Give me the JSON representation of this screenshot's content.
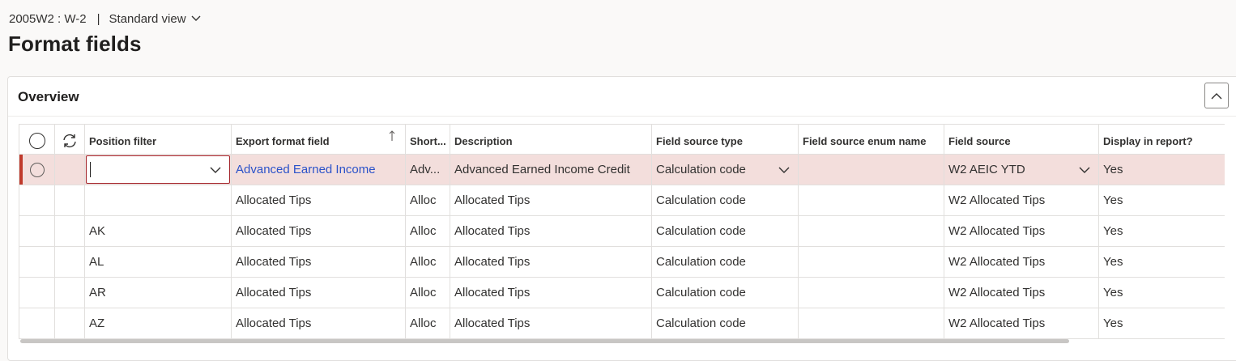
{
  "breadcrumb": {
    "record": "2005W2 : W-2",
    "separator": "|",
    "view": "Standard view"
  },
  "page_title": "Format fields",
  "section": {
    "title": "Overview"
  },
  "columns": [
    "Position filter",
    "Export format field",
    "Short...",
    "Description",
    "Field source type",
    "Field source enum name",
    "Field source",
    "Display in report?"
  ],
  "rows": [
    {
      "position": "",
      "export": "Advanced Earned Income",
      "short": "Adv...",
      "description": "Advanced Earned Income Credit",
      "source_type": "Calculation code",
      "enum_name": "",
      "source": "W2 AEIC YTD",
      "display": "Yes"
    },
    {
      "position": "",
      "export": "Allocated Tips",
      "short": "Alloc",
      "description": "Allocated Tips",
      "source_type": "Calculation code",
      "enum_name": "",
      "source": "W2 Allocated Tips",
      "display": "Yes"
    },
    {
      "position": "AK",
      "export": "Allocated Tips",
      "short": "Alloc",
      "description": "Allocated Tips",
      "source_type": "Calculation code",
      "enum_name": "",
      "source": "W2 Allocated Tips",
      "display": "Yes"
    },
    {
      "position": "AL",
      "export": "Allocated Tips",
      "short": "Alloc",
      "description": "Allocated Tips",
      "source_type": "Calculation code",
      "enum_name": "",
      "source": "W2 Allocated Tips",
      "display": "Yes"
    },
    {
      "position": "AR",
      "export": "Allocated Tips",
      "short": "Alloc",
      "description": "Allocated Tips",
      "source_type": "Calculation code",
      "enum_name": "",
      "source": "W2 Allocated Tips",
      "display": "Yes"
    },
    {
      "position": "AZ",
      "export": "Allocated Tips",
      "short": "Alloc",
      "description": "Allocated Tips",
      "source_type": "Calculation code",
      "enum_name": "",
      "source": "W2 Allocated Tips",
      "display": "Yes"
    }
  ],
  "colors": {
    "link": "#2b52c9",
    "selected_row": "#f3dedc",
    "selection_bar": "#c0392b"
  }
}
